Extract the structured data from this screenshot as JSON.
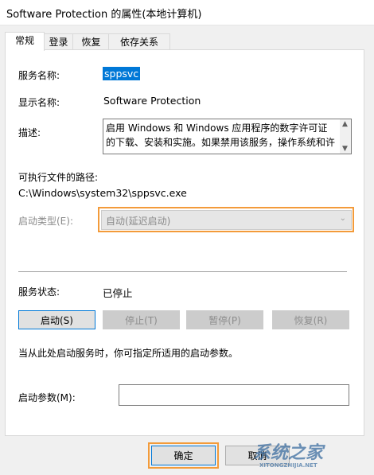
{
  "window": {
    "title": "Software Protection 的属性(本地计算机)"
  },
  "tabs": [
    {
      "label": "常规",
      "active": true
    },
    {
      "label": "登录",
      "active": false
    },
    {
      "label": "恢复",
      "active": false
    },
    {
      "label": "依存关系",
      "active": false
    }
  ],
  "general": {
    "service_name_label": "服务名称:",
    "service_name_value": "sppsvc",
    "display_name_label": "显示名称:",
    "display_name_value": "Software Protection",
    "description_label": "描述:",
    "description_value": "启用 Windows 和 Windows 应用程序的数字许可证的下载、安装和实施。如果禁用该服务，操作系统和许",
    "exe_path_label": "可执行文件的路径:",
    "exe_path_value": "C:\\Windows\\system32\\sppsvc.exe",
    "startup_type_label": "启动类型(E):",
    "startup_type_value": "自动(延迟启动)",
    "service_status_label": "服务状态:",
    "service_status_value": "已停止",
    "buttons": {
      "start": "启动(S)",
      "stop": "停止(T)",
      "pause": "暂停(P)",
      "resume": "恢复(R)"
    },
    "hint_text": "当从此处启动服务时，你可指定所适用的启动参数。",
    "start_params_label": "启动参数(M):",
    "start_params_value": ""
  },
  "footer": {
    "ok_label": "确定",
    "cancel_label": "取消"
  },
  "watermark": {
    "text": "系统之家",
    "sub": "XITONGZHIJIA.NET"
  },
  "colors": {
    "highlight": "#0078d7",
    "callout": "#f39b3a"
  }
}
